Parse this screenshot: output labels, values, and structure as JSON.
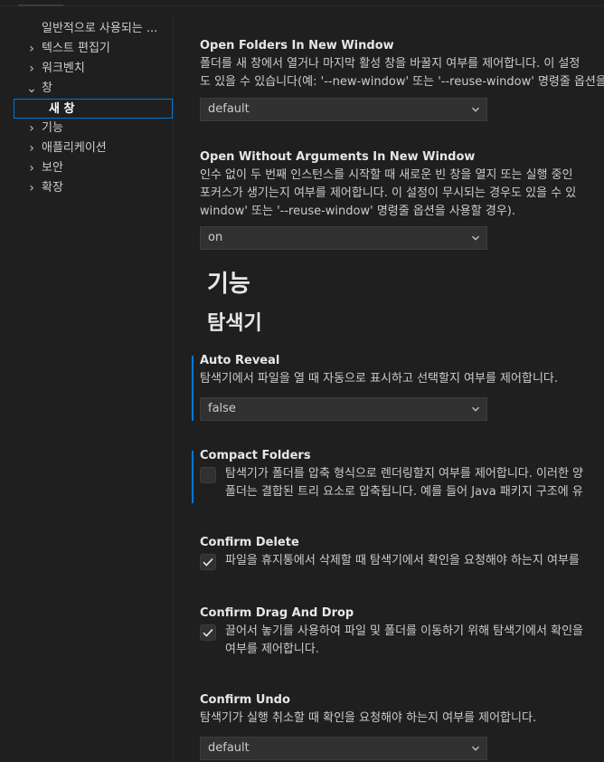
{
  "toc": {
    "items": [
      {
        "label": "일반적으로 사용되는 ...",
        "chevron": ""
      },
      {
        "label": "텍스트 편집기",
        "chevron": "›"
      },
      {
        "label": "워크벤치",
        "chevron": "›"
      },
      {
        "label": "창",
        "chevron": "⌄"
      },
      {
        "label": "새 창",
        "chevron": ""
      },
      {
        "label": "기능",
        "chevron": "›"
      },
      {
        "label": "애플리케이션",
        "chevron": "›"
      },
      {
        "label": "보안",
        "chevron": "›"
      },
      {
        "label": "확장",
        "chevron": "›"
      }
    ],
    "selected": "새 창"
  },
  "settings": {
    "open_folders": {
      "title": "Open Folders In New Window",
      "desc1": "폴더를 새 창에서 열거나 마지막 활성 창을 바꿀지 여부를 제어합니다. 이 설정",
      "desc2": "도 있을 수 있습니다(예: '--new-window' 또는 '--reuse-window' 명령줄 옵션을",
      "value": "default"
    },
    "open_without_args": {
      "title": "Open Without Arguments In New Window",
      "desc1": "인수 없이 두 번째 인스턴스를 시작할 때 새로운 빈 창을 열지 또는 실행 중인",
      "desc2": "포커스가 생기는지 여부를 제어합니다. 이 설정이 무시되는 경우도 있을 수 있",
      "desc3": "window' 또는 '--reuse-window' 명령줄 옵션을 사용할 경우).",
      "value": "on"
    }
  },
  "section": {
    "heading": "기능",
    "subheading": "탐색기"
  },
  "explorer": {
    "auto_reveal": {
      "title": "Auto Reveal",
      "desc": "탐색기에서 파일을 열 때 자동으로 표시하고 선택할지 여부를 제어합니다.",
      "value": "false"
    },
    "compact_folders": {
      "title": "Compact Folders",
      "desc1": "탐색기가 폴더를 압축 형식으로 렌더링할지 여부를 제어합니다. 이러한 양",
      "desc2": "폴더는 결합된 트리 요소로 압축됩니다. 예를 들어 Java 패키지 구조에 유",
      "checked": false
    },
    "confirm_delete": {
      "title": "Confirm Delete",
      "desc": "파일을 휴지통에서 삭제할 때 탐색기에서 확인을 요청해야 하는지 여부를",
      "checked": true
    },
    "confirm_dnd": {
      "title": "Confirm Drag And Drop",
      "desc1": "끌어서 놓기를 사용하여 파일 및 폴더를 이동하기 위해 탐색기에서 확인을",
      "desc2": "여부를 제어합니다.",
      "checked": true
    },
    "confirm_undo": {
      "title": "Confirm Undo",
      "desc": "탐색기가 실행 취소할 때 확인을 요청해야 하는지 여부를 제어합니다.",
      "value": "default"
    }
  },
  "colors": {
    "accent": "#0078d4",
    "background": "#1f1f1f",
    "input_bg": "#313131"
  },
  "icons": {
    "chevron": "chevron-down-icon",
    "check": "check-icon"
  }
}
